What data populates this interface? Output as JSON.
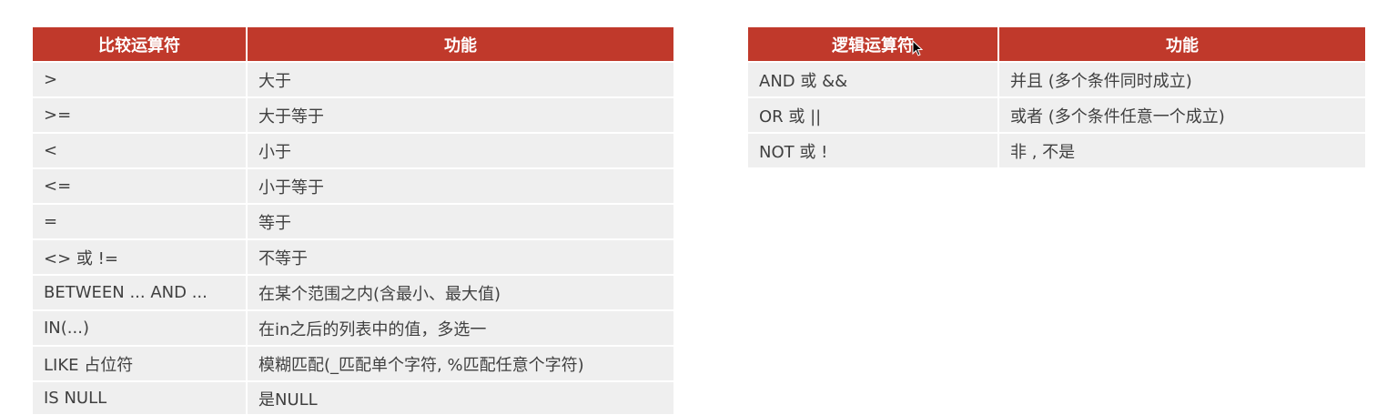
{
  "compare_table": {
    "headers": [
      "比较运算符",
      "功能"
    ],
    "rows": [
      [
        ">",
        "大于"
      ],
      [
        ">=",
        "大于等于"
      ],
      [
        "<",
        "小于"
      ],
      [
        "<=",
        "小于等于"
      ],
      [
        "=",
        "等于"
      ],
      [
        "<> 或 !=",
        "不等于"
      ],
      [
        "BETWEEN ... AND ...",
        "在某个范围之内(含最小、最大值)"
      ],
      [
        "IN(...)",
        "在in之后的列表中的值，多选一"
      ],
      [
        "LIKE  占位符",
        "模糊匹配(_匹配单个字符, %匹配任意个字符)"
      ],
      [
        "IS NULL",
        "是NULL"
      ]
    ]
  },
  "logic_table": {
    "headers": [
      "逻辑运算符",
      "功能"
    ],
    "rows": [
      [
        "AND  或  &&",
        "并且 (多个条件同时成立)"
      ],
      [
        "OR  或  ||",
        "或者 (多个条件任意一个成立)"
      ],
      [
        "NOT  或  !",
        "非 , 不是"
      ]
    ]
  },
  "colors": {
    "header_bg": "#c0392b",
    "row_bg": "#efefef",
    "header_text": "#ffffff"
  },
  "cursor": {
    "icon": "mouse-pointer-icon"
  }
}
